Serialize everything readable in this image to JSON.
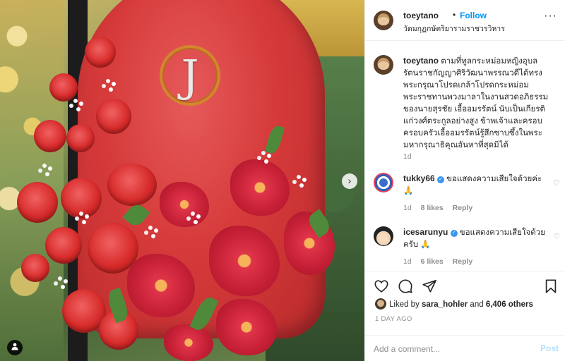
{
  "photo": {
    "next_arrow": "›",
    "tag_icon": "user-tag-icon"
  },
  "header": {
    "username": "toeytano",
    "separator": "•",
    "follow_label": "Follow",
    "location": "วัดมกุฏกษัตริยารามราชวรวิหาร",
    "more": "···"
  },
  "comments": [
    {
      "username": "toeytano",
      "text": "ตามที่ทูลกระหม่อมหญิงอุบลรัตนราชกัญญาศิริวัฒนาพรรณวดีได้ทรงพระกรุณาโปรดเกล้าโปรดกระหม่อมพระราชทานพวงมาลาในงานสวดอภิธรรมของนายสุรชัย เอื้ออมรรัตน์ นับเป็นเกียรติแก่วงศ์ตระกูลอย่างสูง ข้าพเจ้าและครอบครอบครัวเอื้ออมรรัตน์รู้สึกซาบซึ้งในพระมหากรุณาธิคุณอันหาที่สุดมิได้",
      "time": "1d"
    },
    {
      "username": "tukky66",
      "verified": "✓",
      "text": "ขอแสดงความเสียใจด้วยค่ะ 🙏",
      "time": "1d",
      "likes": "8 likes",
      "reply": "Reply"
    },
    {
      "username": "icesarunyu",
      "verified": "✓",
      "text": "ขอแสดงความเสียใจด้วยครับ 🙏",
      "time": "1d",
      "likes": "6 likes",
      "reply": "Reply"
    }
  ],
  "actions": {
    "liked_prefix": "Liked by ",
    "liked_user": "sara_hohler",
    "liked_mid": " and ",
    "liked_count": "6,406 others",
    "time_ago": "1 DAY AGO"
  },
  "add_comment": {
    "placeholder": "Add a comment...",
    "post_label": "Post"
  },
  "colors": {
    "accent": "#0095f6",
    "post_disabled": "#b2dffc",
    "muted": "#8e8e8e"
  }
}
